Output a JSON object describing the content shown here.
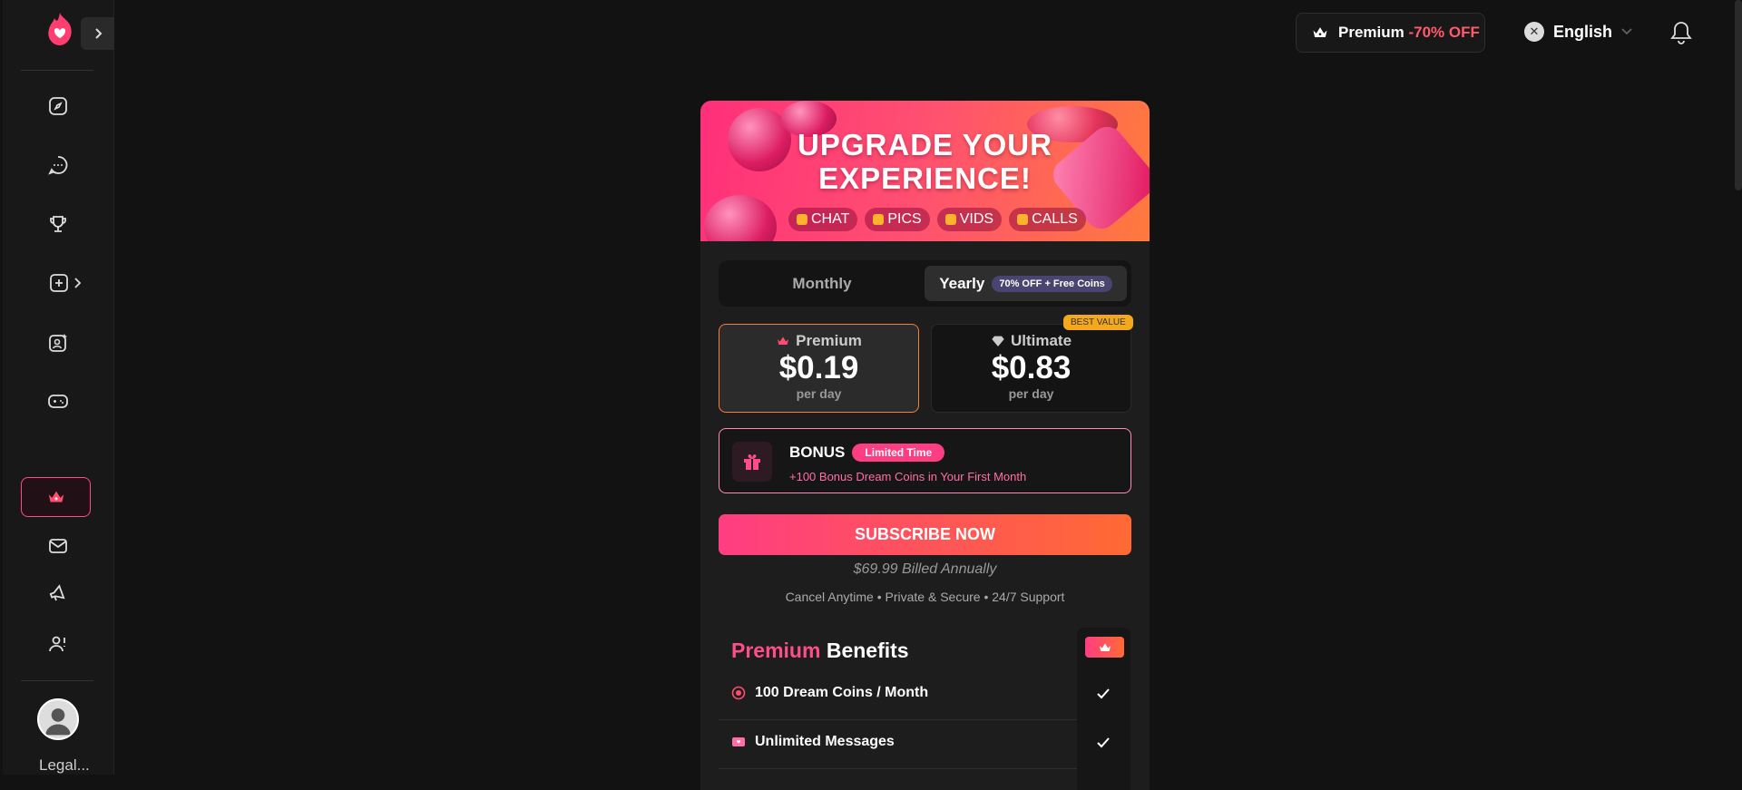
{
  "topbar": {
    "premium_label": "Premium",
    "premium_off": "-70% OFF",
    "language": "English"
  },
  "sidebar": {
    "items": [
      "compass-icon",
      "chat-icon",
      "trophy-icon",
      "create-icon",
      "character-icon",
      "gamepad-icon"
    ],
    "premium": "crown-icon",
    "bottom_items": [
      "mail-icon",
      "megaphone-icon",
      "affiliate-icon"
    ],
    "legal": "Legal..."
  },
  "banner": {
    "title_line1": "UPGRADE YOUR",
    "title_line2": "EXPERIENCE!",
    "chips": [
      "CHAT",
      "PICS",
      "VIDS",
      "CALLS"
    ]
  },
  "billing_toggle": {
    "monthly": "Monthly",
    "yearly": "Yearly",
    "yearly_badge": "70% OFF + Free Coins"
  },
  "plans": [
    {
      "name": "Premium",
      "price": "$0.19",
      "unit": "per day"
    },
    {
      "name": "Ultimate",
      "price": "$0.83",
      "unit": "per day",
      "badge": "BEST VALUE"
    }
  ],
  "bonus": {
    "title": "BONUS",
    "badge": "Limited Time",
    "description": "+100 Bonus Dream Coins in Your First Month"
  },
  "subscribe": {
    "button": "SUBSCRIBE NOW",
    "billed": "$69.99 Billed Annually",
    "tagline": "Cancel Anytime • Private & Secure • 24/7 Support"
  },
  "benefits": {
    "title_accent": "Premium",
    "title_rest": "Benefits",
    "items": [
      "100 Dream Coins / Month",
      "Unlimited Messages"
    ]
  },
  "colors": {
    "accent_pink": "#ff3d82",
    "accent_orange": "#ff6a33",
    "background": "#121212"
  }
}
